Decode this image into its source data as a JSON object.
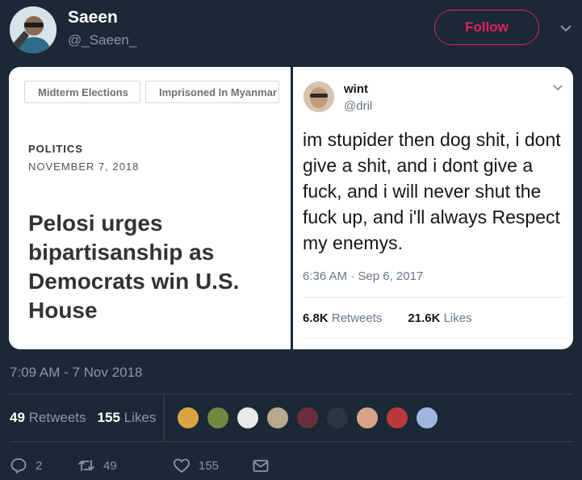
{
  "user": {
    "name": "Saeen",
    "handle": "@_Saeen_"
  },
  "follow_label": "Follow",
  "article": {
    "tags": [
      "Midterm Elections",
      "Imprisoned In Myanmar"
    ],
    "section": "POLITICS",
    "date": "NOVEMBER 7, 2018",
    "headline": "Pelosi urges bipartisanship as Democrats win U.S. House"
  },
  "quoted_tweet": {
    "name": "wint",
    "handle": "@dril",
    "text": "im stupider then dog shit, i dont give a shit, and i dont give a fuck, and i will never shut the fuck up, and i'll always Respect my enemys.",
    "time": "6:36 AM · Sep 6, 2017",
    "retweets_count": "6.8K",
    "retweets_label": "Retweets",
    "likes_count": "21.6K",
    "likes_label": "Likes"
  },
  "timestamp": "7:09 AM - 7 Nov 2018",
  "stats": {
    "retweets_count": "49",
    "retweets_label": "Retweets",
    "likes_count": "155",
    "likes_label": "Likes"
  },
  "liker_colors": [
    "#d9a441",
    "#6e8a3e",
    "#e9e9e9",
    "#b9a78f",
    "#6b2e3f",
    "#2c3540",
    "#d7a48a",
    "#b83b3b",
    "#9fb7e0"
  ],
  "actions": {
    "replies": "2",
    "retweets": "49",
    "likes": "155"
  },
  "icons": [
    "chevron-down-icon",
    "reply-icon",
    "retweet-icon",
    "heart-icon",
    "envelope-icon"
  ]
}
